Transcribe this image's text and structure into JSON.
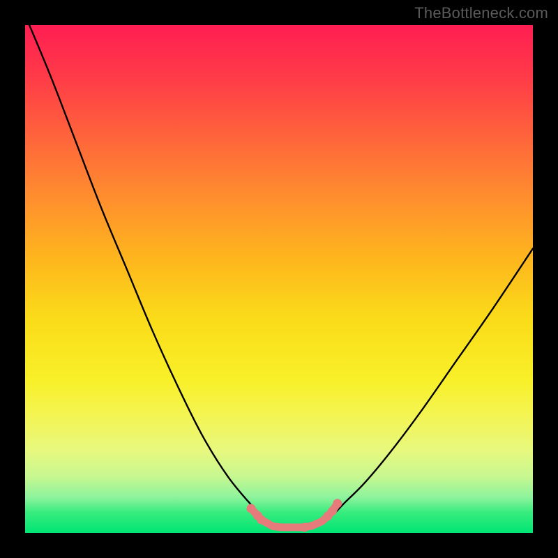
{
  "watermark": "TheBottleneck.com",
  "colors": {
    "frame": "#000000",
    "gradient_top": "#FF1E52",
    "gradient_bottom": "#00E574",
    "curve": "#000000",
    "blob": "#E57B7B"
  },
  "chart_data": {
    "type": "line",
    "title": "",
    "xlabel": "",
    "ylabel": "",
    "xlim": [
      0,
      100
    ],
    "ylim": [
      0,
      100
    ],
    "grid": false,
    "legend": null,
    "annotations": [],
    "x": [
      0,
      5,
      10,
      15,
      20,
      25,
      30,
      35,
      40,
      45,
      48,
      50,
      52,
      55,
      58,
      60,
      63,
      67,
      72,
      78,
      85,
      92,
      100
    ],
    "values": [
      102,
      90,
      77,
      64,
      52,
      40,
      29,
      19,
      11,
      5,
      2,
      1,
      1,
      1,
      2,
      3,
      6,
      10,
      16,
      24,
      34,
      44,
      56
    ],
    "note": "Values are bottleneck percentage; plot origin is bottom-left (y increases upward). Curve is a V-shaped bottleneck chart with minimum near x≈50.",
    "blob_points": [
      {
        "x": 44.5,
        "y": 4.8
      },
      {
        "x": 45.8,
        "y": 3.4
      },
      {
        "x": 46.5,
        "y": 2.6
      },
      {
        "x": 48.8,
        "y": 1.3
      },
      {
        "x": 50.5,
        "y": 1.1
      },
      {
        "x": 53.0,
        "y": 1.1
      },
      {
        "x": 55.0,
        "y": 1.1
      },
      {
        "x": 56.5,
        "y": 1.4
      },
      {
        "x": 58.5,
        "y": 2.3
      },
      {
        "x": 59.6,
        "y": 3.3
      },
      {
        "x": 60.5,
        "y": 4.3
      },
      {
        "x": 61.5,
        "y": 5.8
      }
    ]
  }
}
